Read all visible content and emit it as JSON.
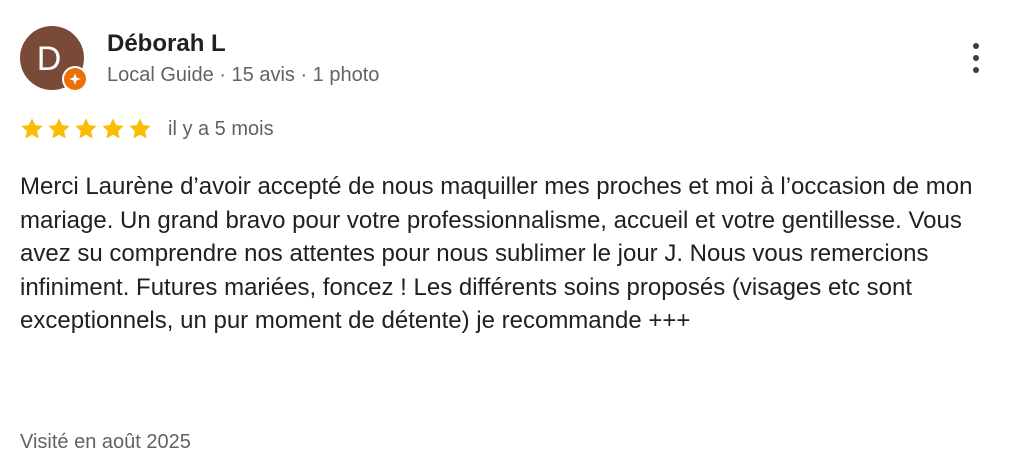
{
  "author": {
    "initial": "D",
    "name": "Déborah L",
    "meta": "Local Guide · 15 avis · 1 photo",
    "avatar_color": "#7a4a38",
    "badge_color": "#e8710a",
    "badge_icon": "local-guide-star-icon"
  },
  "menu": {
    "icon": "more-vert-icon"
  },
  "review": {
    "rating": 5,
    "rating_max": 5,
    "star_color": "#fbbc04",
    "date": "il y a 5 mois",
    "text": "Merci Laurène d’avoir accepté de nous maquiller mes proches et moi à l’occasion de mon mariage. Un grand bravo pour votre professionnalisme, accueil et votre gentillesse. Vous avez su comprendre nos attentes pour nous sublimer le jour J. Nous vous remercions infiniment. Futures mariées, foncez ! Les différents soins proposés (visages etc sont exceptionnels, un pur moment de détente) je recommande +++",
    "visit": "Visité en août 2025"
  }
}
